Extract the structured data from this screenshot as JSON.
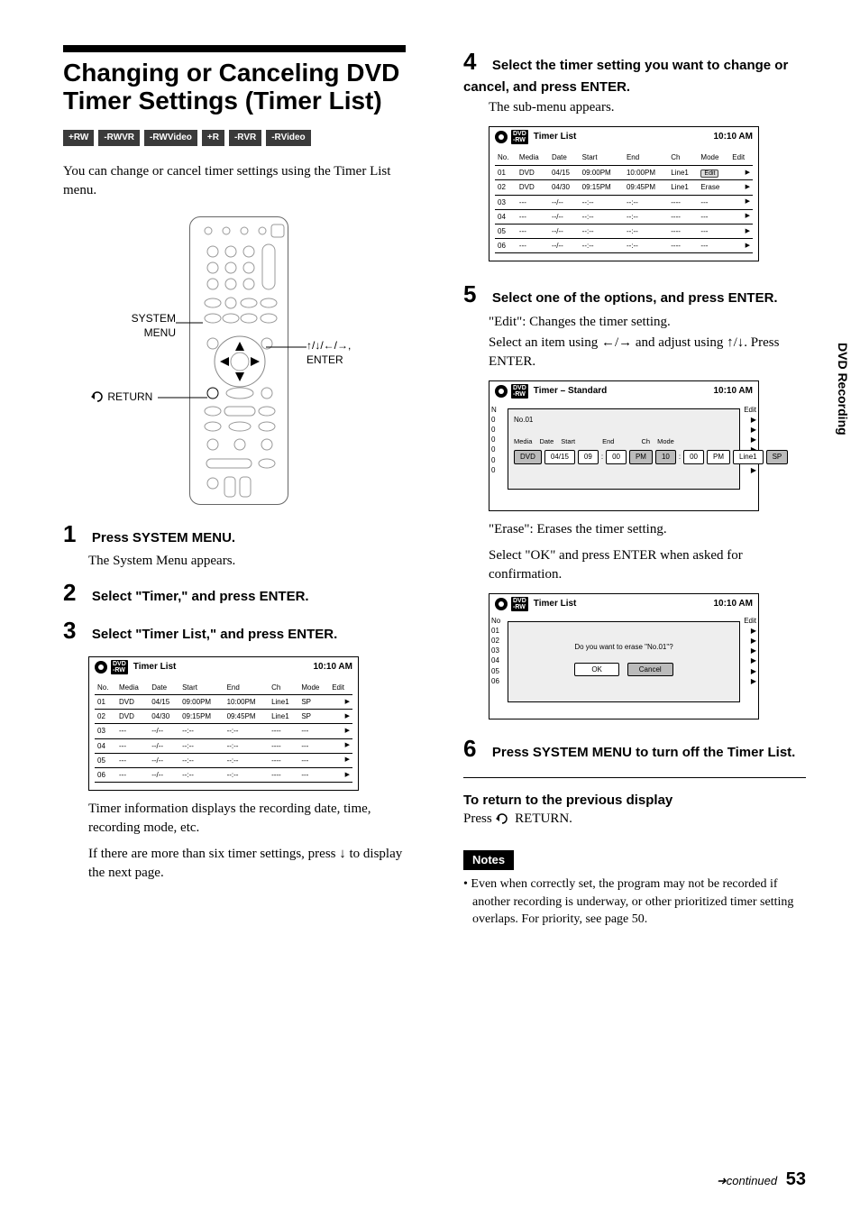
{
  "side_tab": "DVD Recording",
  "page": {
    "continued": "continued",
    "number": "53"
  },
  "left": {
    "title": "Changing or Canceling DVD Timer Settings (Timer List)",
    "badges": [
      "+RW",
      "-RWVR",
      "-RWVideo",
      "+R",
      "-RVR",
      "-RVideo"
    ],
    "intro": "You can change or cancel timer settings using the Timer List menu.",
    "labels": {
      "system_menu": "SYSTEM\nMENU",
      "return": "RETURN",
      "enter_group": "↑/↓/←/→,\nENTER"
    },
    "steps": {
      "s1_num": "1",
      "s1_title": "Press SYSTEM MENU.",
      "s1_desc": "The System Menu appears.",
      "s2_num": "2",
      "s2_title": "Select \"Timer,\" and press ENTER.",
      "s3_num": "3",
      "s3_title": "Select \"Timer List,\" and press ENTER."
    },
    "panel1": {
      "title": "Timer List",
      "clock": "10:10 AM",
      "cols": [
        "No.",
        "Media",
        "Date",
        "Start",
        "End",
        "Ch",
        "Mode",
        "Edit"
      ],
      "rows": [
        {
          "no": "01",
          "media": "DVD",
          "date": "04/15",
          "start": "09:00PM",
          "end": "10:00PM",
          "ch": "Line1",
          "mode": "SP"
        },
        {
          "no": "02",
          "media": "DVD",
          "date": "04/30",
          "start": "09:15PM",
          "end": "09:45PM",
          "ch": "Line1",
          "mode": "SP"
        },
        {
          "no": "03",
          "media": "---",
          "date": "--/--",
          "start": "--:--",
          "end": "--:--",
          "ch": "----",
          "mode": "---"
        },
        {
          "no": "04",
          "media": "---",
          "date": "--/--",
          "start": "--:--",
          "end": "--:--",
          "ch": "----",
          "mode": "---"
        },
        {
          "no": "05",
          "media": "---",
          "date": "--/--",
          "start": "--:--",
          "end": "--:--",
          "ch": "----",
          "mode": "---"
        },
        {
          "no": "06",
          "media": "---",
          "date": "--/--",
          "start": "--:--",
          "end": "--:--",
          "ch": "----",
          "mode": "---"
        }
      ]
    },
    "after_panel1_a": "Timer information displays the recording date, time, recording mode, etc.",
    "after_panel1_b": "If there are more than six timer settings, press ↓ to display the next page."
  },
  "right": {
    "s4_num": "4",
    "s4_title": "Select the timer setting you want to change or cancel, and press ENTER.",
    "s4_desc": "The sub-menu appears.",
    "panel2": {
      "title": "Timer List",
      "clock": "10:10 AM",
      "cols": [
        "No.",
        "Media",
        "Date",
        "Start",
        "End",
        "Ch",
        "Mode",
        "Edit"
      ],
      "edit_label": "Edit",
      "erase_label": "Erase",
      "rows": [
        {
          "no": "01",
          "media": "DVD",
          "date": "04/15",
          "start": "09:00PM",
          "end": "10:00PM",
          "ch": "Line1"
        },
        {
          "no": "02",
          "media": "DVD",
          "date": "04/30",
          "start": "09:15PM",
          "end": "09:45PM",
          "ch": "Line1"
        },
        {
          "no": "03",
          "media": "---",
          "date": "--/--",
          "start": "--:--",
          "end": "--:--",
          "ch": "----",
          "mode": "---"
        },
        {
          "no": "04",
          "media": "---",
          "date": "--/--",
          "start": "--:--",
          "end": "--:--",
          "ch": "----",
          "mode": "---"
        },
        {
          "no": "05",
          "media": "---",
          "date": "--/--",
          "start": "--:--",
          "end": "--:--",
          "ch": "----",
          "mode": "---"
        },
        {
          "no": "06",
          "media": "---",
          "date": "--/--",
          "start": "--:--",
          "end": "--:--",
          "ch": "----",
          "mode": "---"
        }
      ]
    },
    "s5_num": "5",
    "s5_title": "Select one of the options, and press ENTER.",
    "s5_desc_a": "\"Edit\": Changes the timer setting.",
    "s5_desc_b": "Select an item using ←/→ and adjust using ↑/↓. Press ENTER.",
    "panel3": {
      "title": "Timer – Standard",
      "clock": "10:10 AM",
      "overlay_no": "No.01",
      "labels": [
        "Media",
        "Date",
        "Start",
        "End",
        "Ch",
        "Mode"
      ],
      "values": {
        "media": "DVD",
        "date": "04/15",
        "start_h": "09",
        "start_m": "00",
        "start_ap": "PM",
        "end_h": "10",
        "end_m": "00",
        "end_ap": "PM",
        "ch": "Line1",
        "mode": "SP"
      },
      "side": "Edit"
    },
    "erase_a": "\"Erase\": Erases the timer setting.",
    "erase_b": "Select \"OK\" and press ENTER when asked for confirmation.",
    "panel4": {
      "title": "Timer List",
      "clock": "10:10 AM",
      "msg": "Do you want to erase \"No.01\"?",
      "ok": "OK",
      "cancel": "Cancel",
      "side": "Edit"
    },
    "s6_num": "6",
    "s6_title": "Press SYSTEM MENU to turn off the Timer List.",
    "return_h": "To return to the previous display",
    "return_t": "Press    RETURN.",
    "notes_label": "Notes",
    "note1": "• Even when correctly set, the program may not be recorded if another recording is underway, or other prioritized timer setting overlaps. For priority, see page 50."
  }
}
